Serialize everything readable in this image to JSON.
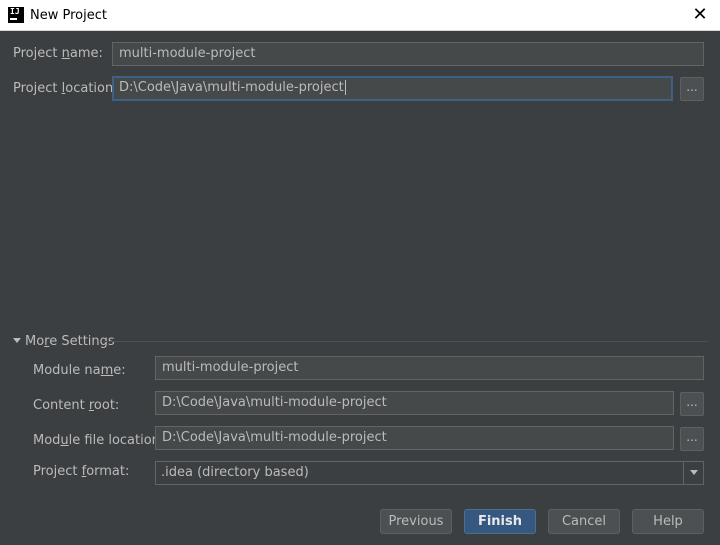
{
  "window": {
    "title": "New Project",
    "app_icon_text": "IJ",
    "close_glyph": "✕"
  },
  "fields": {
    "project_name": {
      "label": "Project name:",
      "value": "multi-module-project"
    },
    "project_location": {
      "label": "Project location:",
      "value": "D:\\Code\\Java\\multi-module-project",
      "browse_label": "..."
    }
  },
  "more_settings": {
    "label": "More Settings",
    "expanded": true,
    "module_name": {
      "label": "Module name:",
      "value": "multi-module-project"
    },
    "content_root": {
      "label": "Content root:",
      "value": "D:\\Code\\Java\\multi-module-project",
      "browse_label": "..."
    },
    "module_file_location": {
      "label": "Module file location:",
      "value": "D:\\Code\\Java\\multi-module-project",
      "browse_label": "..."
    },
    "project_format": {
      "label": "Project format:",
      "selected": ".idea (directory based)"
    }
  },
  "buttons": {
    "previous": "Previous",
    "finish": "Finish",
    "cancel": "Cancel",
    "help": "Help"
  },
  "colors": {
    "background": "#3c3f41",
    "field_background": "#45494a",
    "focus_border": "#3d6185",
    "default_button": "#365880"
  }
}
